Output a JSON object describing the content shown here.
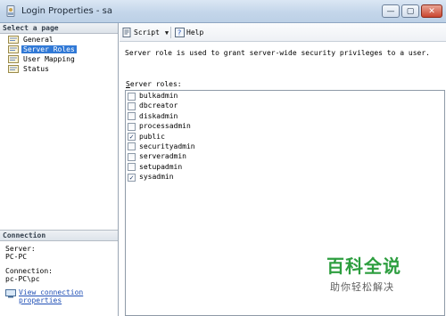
{
  "window": {
    "title": "Login Properties - sa",
    "buttons": {
      "minimize": "—",
      "maximize": "▢",
      "close": "✕"
    }
  },
  "left_panel": {
    "select_page_header": "Select a page",
    "pages": [
      {
        "label": "General",
        "icon": "page-icon",
        "selected": false
      },
      {
        "label": "Server Roles",
        "icon": "page-icon",
        "selected": true
      },
      {
        "label": "User Mapping",
        "icon": "page-icon",
        "selected": false
      },
      {
        "label": "Status",
        "icon": "page-icon",
        "selected": false
      }
    ],
    "connection": {
      "header": "Connection",
      "server_label": "Server:",
      "server_value": "PC-PC",
      "connection_label": "Connection:",
      "connection_value": "pc-PC\\pc",
      "view_link_line1": "View connection",
      "view_link_line2": "properties"
    }
  },
  "toolbar": {
    "script_label": "Script",
    "help_label": "Help"
  },
  "main": {
    "description": "Server role is used to grant server-wide security privileges to a user.",
    "roles_label": "Server roles:",
    "roles": [
      {
        "name": "bulkadmin",
        "checked": false
      },
      {
        "name": "dbcreator",
        "checked": false
      },
      {
        "name": "diskadmin",
        "checked": false
      },
      {
        "name": "processadmin",
        "checked": false
      },
      {
        "name": "public",
        "checked": true
      },
      {
        "name": "securityadmin",
        "checked": false
      },
      {
        "name": "serveradmin",
        "checked": false
      },
      {
        "name": "setupadmin",
        "checked": false
      },
      {
        "name": "sysadmin",
        "checked": true
      }
    ]
  },
  "watermark": {
    "main": "百科全说",
    "sub": "助你轻松解决"
  },
  "colors": {
    "selection": "#3179d6",
    "link": "#1f4fb5",
    "watermark_green": "#2d9e3f"
  }
}
